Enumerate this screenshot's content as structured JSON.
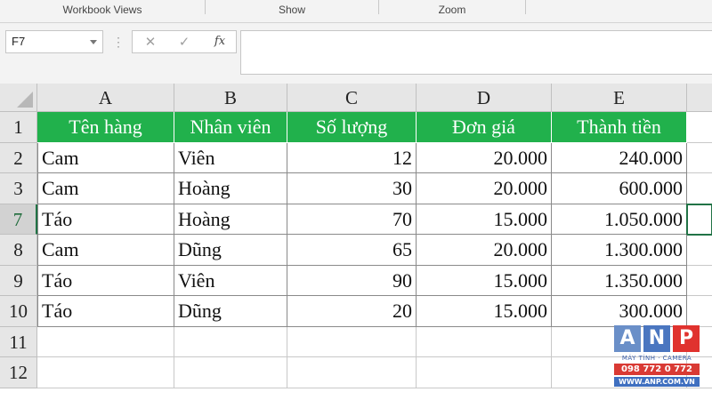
{
  "ribbon": {
    "groups": [
      "Workbook Views",
      "Show",
      "Zoom"
    ]
  },
  "formula_bar": {
    "name_box": "F7",
    "cancel_icon": "✕",
    "enter_icon": "✓",
    "fx_label": "fx",
    "formula": ""
  },
  "sheet": {
    "columns": [
      "A",
      "B",
      "C",
      "D",
      "E"
    ],
    "rows": [
      {
        "num": "1",
        "cells": [
          "Tên hàng",
          "Nhân viên",
          "Số lượng",
          "Đơn giá",
          "Thành tiền"
        ]
      },
      {
        "num": "2",
        "cells": [
          "Cam",
          "Viên",
          "12",
          "20.000",
          "240.000"
        ]
      },
      {
        "num": "3",
        "cells": [
          "Cam",
          "Hoàng",
          "30",
          "20.000",
          "600.000"
        ]
      },
      {
        "num": "7",
        "cells": [
          "Táo",
          "Hoàng",
          "70",
          "15.000",
          "1.050.000"
        ]
      },
      {
        "num": "8",
        "cells": [
          "Cam",
          "Dũng",
          "65",
          "20.000",
          "1.300.000"
        ]
      },
      {
        "num": "9",
        "cells": [
          "Táo",
          "Viên",
          "90",
          "15.000",
          "1.350.000"
        ]
      },
      {
        "num": "10",
        "cells": [
          "Táo",
          "Dũng",
          "20",
          "15.000",
          "300.000"
        ]
      },
      {
        "num": "11",
        "cells": [
          "",
          "",
          "",
          "",
          ""
        ]
      },
      {
        "num": "12",
        "cells": [
          "",
          "",
          "",
          "",
          ""
        ]
      }
    ],
    "active_row": "7",
    "active_cell": "F7",
    "header_color": "#21B14C"
  },
  "watermark": {
    "letters": [
      "A",
      "N",
      "P"
    ],
    "line1": "MÁY TÍNH · CAMERA",
    "line2": "098 772 0 772",
    "line3": "WWW.ANP.COM.VN",
    "colors": [
      "#6a8fc8",
      "#4a76c0",
      "#e0322e"
    ]
  }
}
